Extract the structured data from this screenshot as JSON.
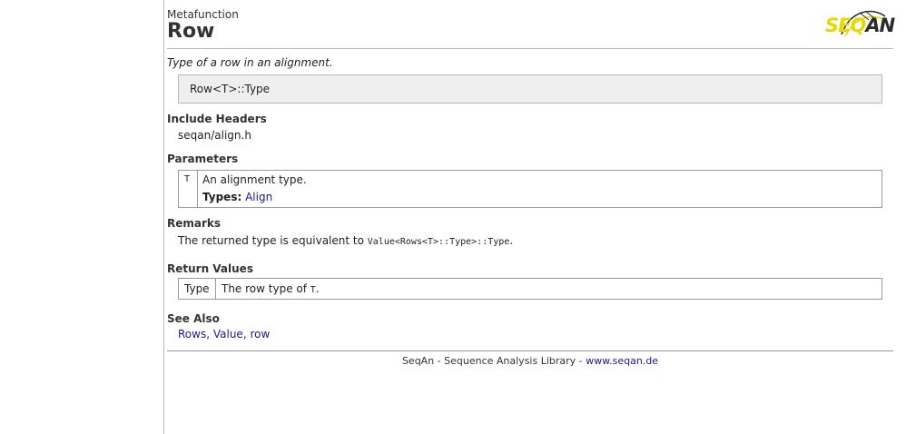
{
  "header": {
    "kind": "Metafunction",
    "title": "Row",
    "logo_text_a": "SEQ",
    "logo_text_b": "AN"
  },
  "summary": "Type of a row in an alignment.",
  "signature": "Row<T>::Type",
  "include": {
    "heading": "Include Headers",
    "value": "seqan/align.h"
  },
  "parameters": {
    "heading": "Parameters",
    "name": "T",
    "description": "An alignment type.",
    "types_label": "Types:",
    "types_link": "Align"
  },
  "remarks": {
    "heading": "Remarks",
    "text_before": "The returned type is equivalent to ",
    "code": "Value<Rows<T>::Type>::Type",
    "text_after": "."
  },
  "return_values": {
    "heading": "Return Values",
    "name": "Type",
    "text_before": "The row type of ",
    "code": "T",
    "text_after": "."
  },
  "see_also": {
    "heading": "See Also",
    "links": [
      "Rows",
      "Value",
      "row"
    ],
    "sep": ", "
  },
  "footer": {
    "text": "SeqAn - Sequence Analysis Library - ",
    "link": "www.seqan.de"
  },
  "colors": {
    "link": "#1a1a8c",
    "logo_yellow": "#e8d800"
  }
}
